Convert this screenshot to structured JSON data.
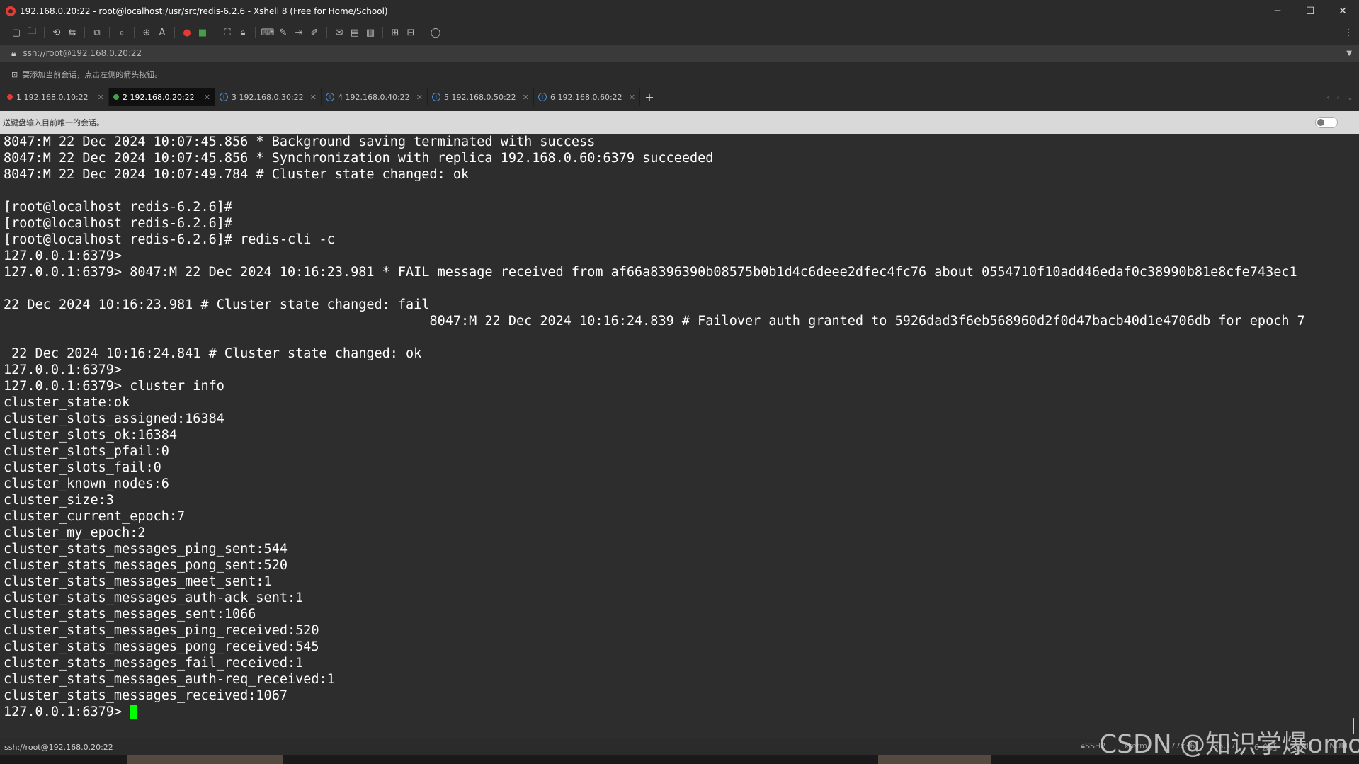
{
  "window": {
    "title": "192.168.0.20:22 - root@localhost:/usr/src/redis-6.2.6 - Xshell 8 (Free for Home/School)",
    "minimize": "─",
    "maximize": "☐",
    "close": "✕"
  },
  "address": {
    "value": "ssh://root@192.168.0.20:22"
  },
  "hint": {
    "text": "要添加当前会话，点击左侧的箭头按钮。"
  },
  "tabs": [
    {
      "label": "1 192.168.0.10:22",
      "status": "red",
      "active": false
    },
    {
      "label": "2 192.168.0.20:22",
      "status": "green",
      "active": true
    },
    {
      "label": "3 192.168.0.30:22",
      "status": "info",
      "active": false
    },
    {
      "label": "4 192.168.0.40:22",
      "status": "info",
      "active": false
    },
    {
      "label": "5 192.168.0.50:22",
      "status": "info",
      "active": false
    },
    {
      "label": "6 192.168.0.60:22",
      "status": "info",
      "active": false
    }
  ],
  "sendbar": {
    "text": "送键盘输入目前唯一的会话。"
  },
  "terminal": {
    "lines": [
      "8047:M 22 Dec 2024 10:07:45.856 * Background saving terminated with success",
      "8047:M 22 Dec 2024 10:07:45.856 * Synchronization with replica 192.168.0.60:6379 succeeded",
      "8047:M 22 Dec 2024 10:07:49.784 # Cluster state changed: ok",
      "",
      "[root@localhost redis-6.2.6]#",
      "[root@localhost redis-6.2.6]#",
      "[root@localhost redis-6.2.6]# redis-cli -c",
      "127.0.0.1:6379>",
      "127.0.0.1:6379> 8047:M 22 Dec 2024 10:16:23.981 * FAIL message received from af66a8396390b08575b0b1d4c6deee2dfec4fc76 about 0554710f10add46edaf0c38990b81e8cfe743ec1",
      "                                                                                                                                                                              8047:M",
      "22 Dec 2024 10:16:23.981 # Cluster state changed: fail",
      "                                                      8047:M 22 Dec 2024 10:16:24.839 # Failover auth granted to 5926dad3f6eb568960d2f0d47bacb40d1e4706db for epoch 7",
      "                                                                                                                                                                               8047:M",
      " 22 Dec 2024 10:16:24.841 # Cluster state changed: ok",
      "127.0.0.1:6379>",
      "127.0.0.1:6379> cluster info",
      "cluster_state:ok",
      "cluster_slots_assigned:16384",
      "cluster_slots_ok:16384",
      "cluster_slots_pfail:0",
      "cluster_slots_fail:0",
      "cluster_known_nodes:6",
      "cluster_size:3",
      "cluster_current_epoch:7",
      "cluster_my_epoch:2",
      "cluster_stats_messages_ping_sent:544",
      "cluster_stats_messages_pong_sent:520",
      "cluster_stats_messages_meet_sent:1",
      "cluster_stats_messages_auth-ack_sent:1",
      "cluster_stats_messages_sent:1066",
      "cluster_stats_messages_ping_received:520",
      "cluster_stats_messages_pong_received:545",
      "cluster_stats_messages_fail_received:1",
      "cluster_stats_messages_auth-req_received:1",
      "cluster_stats_messages_received:1067"
    ],
    "prompt": "127.0.0.1:6379> "
  },
  "status": {
    "connection": "ssh://root@192.168.0.20:22",
    "protocol": "SSH2",
    "term": "xterm",
    "size": "177x36",
    "pos": "36,17",
    "sessions": "6 会话",
    "caps": "CAP",
    "num": "NUM"
  },
  "watermark": "CSDN @知识学爆omo"
}
